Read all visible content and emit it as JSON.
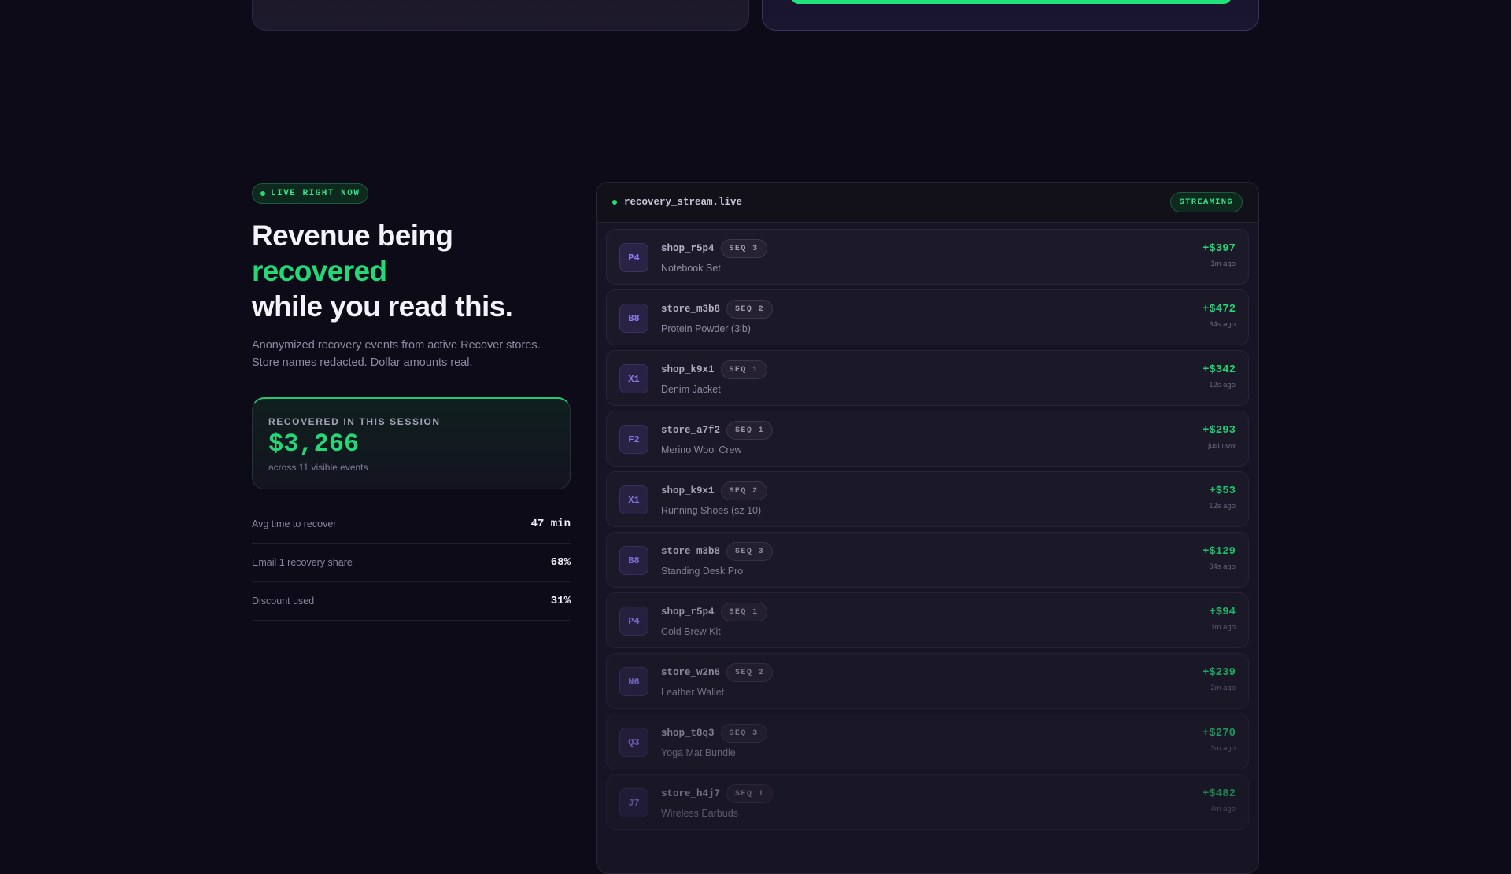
{
  "live_label": "LIVE RIGHT NOW",
  "headline": {
    "line1": "Revenue being",
    "accent": "recovered",
    "line3": "while you read this."
  },
  "subtitle": "Anonymized recovery events from active Recover stores. Store names redacted. Dollar amounts real.",
  "session": {
    "label": "RECOVERED IN THIS SESSION",
    "value": "$3,266",
    "note": "across 11 visible events"
  },
  "stats": [
    {
      "label": "Avg time to recover",
      "value": "47 min"
    },
    {
      "label": "Email 1 recovery share",
      "value": "68%"
    },
    {
      "label": "Discount used",
      "value": "31%"
    }
  ],
  "stream": {
    "title": "recovery_stream.live",
    "badge": "STREAMING",
    "events": [
      {
        "avatar": "P4",
        "shop": "shop_r5p4",
        "seq": "SEQ 3",
        "product": "Notebook Set",
        "amount": "+$397",
        "ago": "1m ago"
      },
      {
        "avatar": "B8",
        "shop": "store_m3b8",
        "seq": "SEQ 2",
        "product": "Protein Powder (3lb)",
        "amount": "+$472",
        "ago": "34s ago"
      },
      {
        "avatar": "X1",
        "shop": "shop_k9x1",
        "seq": "SEQ 1",
        "product": "Denim Jacket",
        "amount": "+$342",
        "ago": "12s ago"
      },
      {
        "avatar": "F2",
        "shop": "store_a7f2",
        "seq": "SEQ 1",
        "product": "Merino Wool Crew",
        "amount": "+$293",
        "ago": "just now"
      },
      {
        "avatar": "X1",
        "shop": "shop_k9x1",
        "seq": "SEQ 2",
        "product": "Running Shoes (sz 10)",
        "amount": "+$53",
        "ago": "12s ago"
      },
      {
        "avatar": "B8",
        "shop": "store_m3b8",
        "seq": "SEQ 3",
        "product": "Standing Desk Pro",
        "amount": "+$129",
        "ago": "34s ago"
      },
      {
        "avatar": "P4",
        "shop": "shop_r5p4",
        "seq": "SEQ 1",
        "product": "Cold Brew Kit",
        "amount": "+$94",
        "ago": "1m ago"
      },
      {
        "avatar": "N6",
        "shop": "store_w2n6",
        "seq": "SEQ 2",
        "product": "Leather Wallet",
        "amount": "+$239",
        "ago": "2m ago"
      },
      {
        "avatar": "Q3",
        "shop": "shop_t8q3",
        "seq": "SEQ 3",
        "product": "Yoga Mat Bundle",
        "amount": "+$270",
        "ago": "3m ago"
      },
      {
        "avatar": "J7",
        "shop": "store_h4j7",
        "seq": "SEQ 1",
        "product": "Wireless Earbuds",
        "amount": "+$482",
        "ago": "4m ago"
      }
    ]
  }
}
